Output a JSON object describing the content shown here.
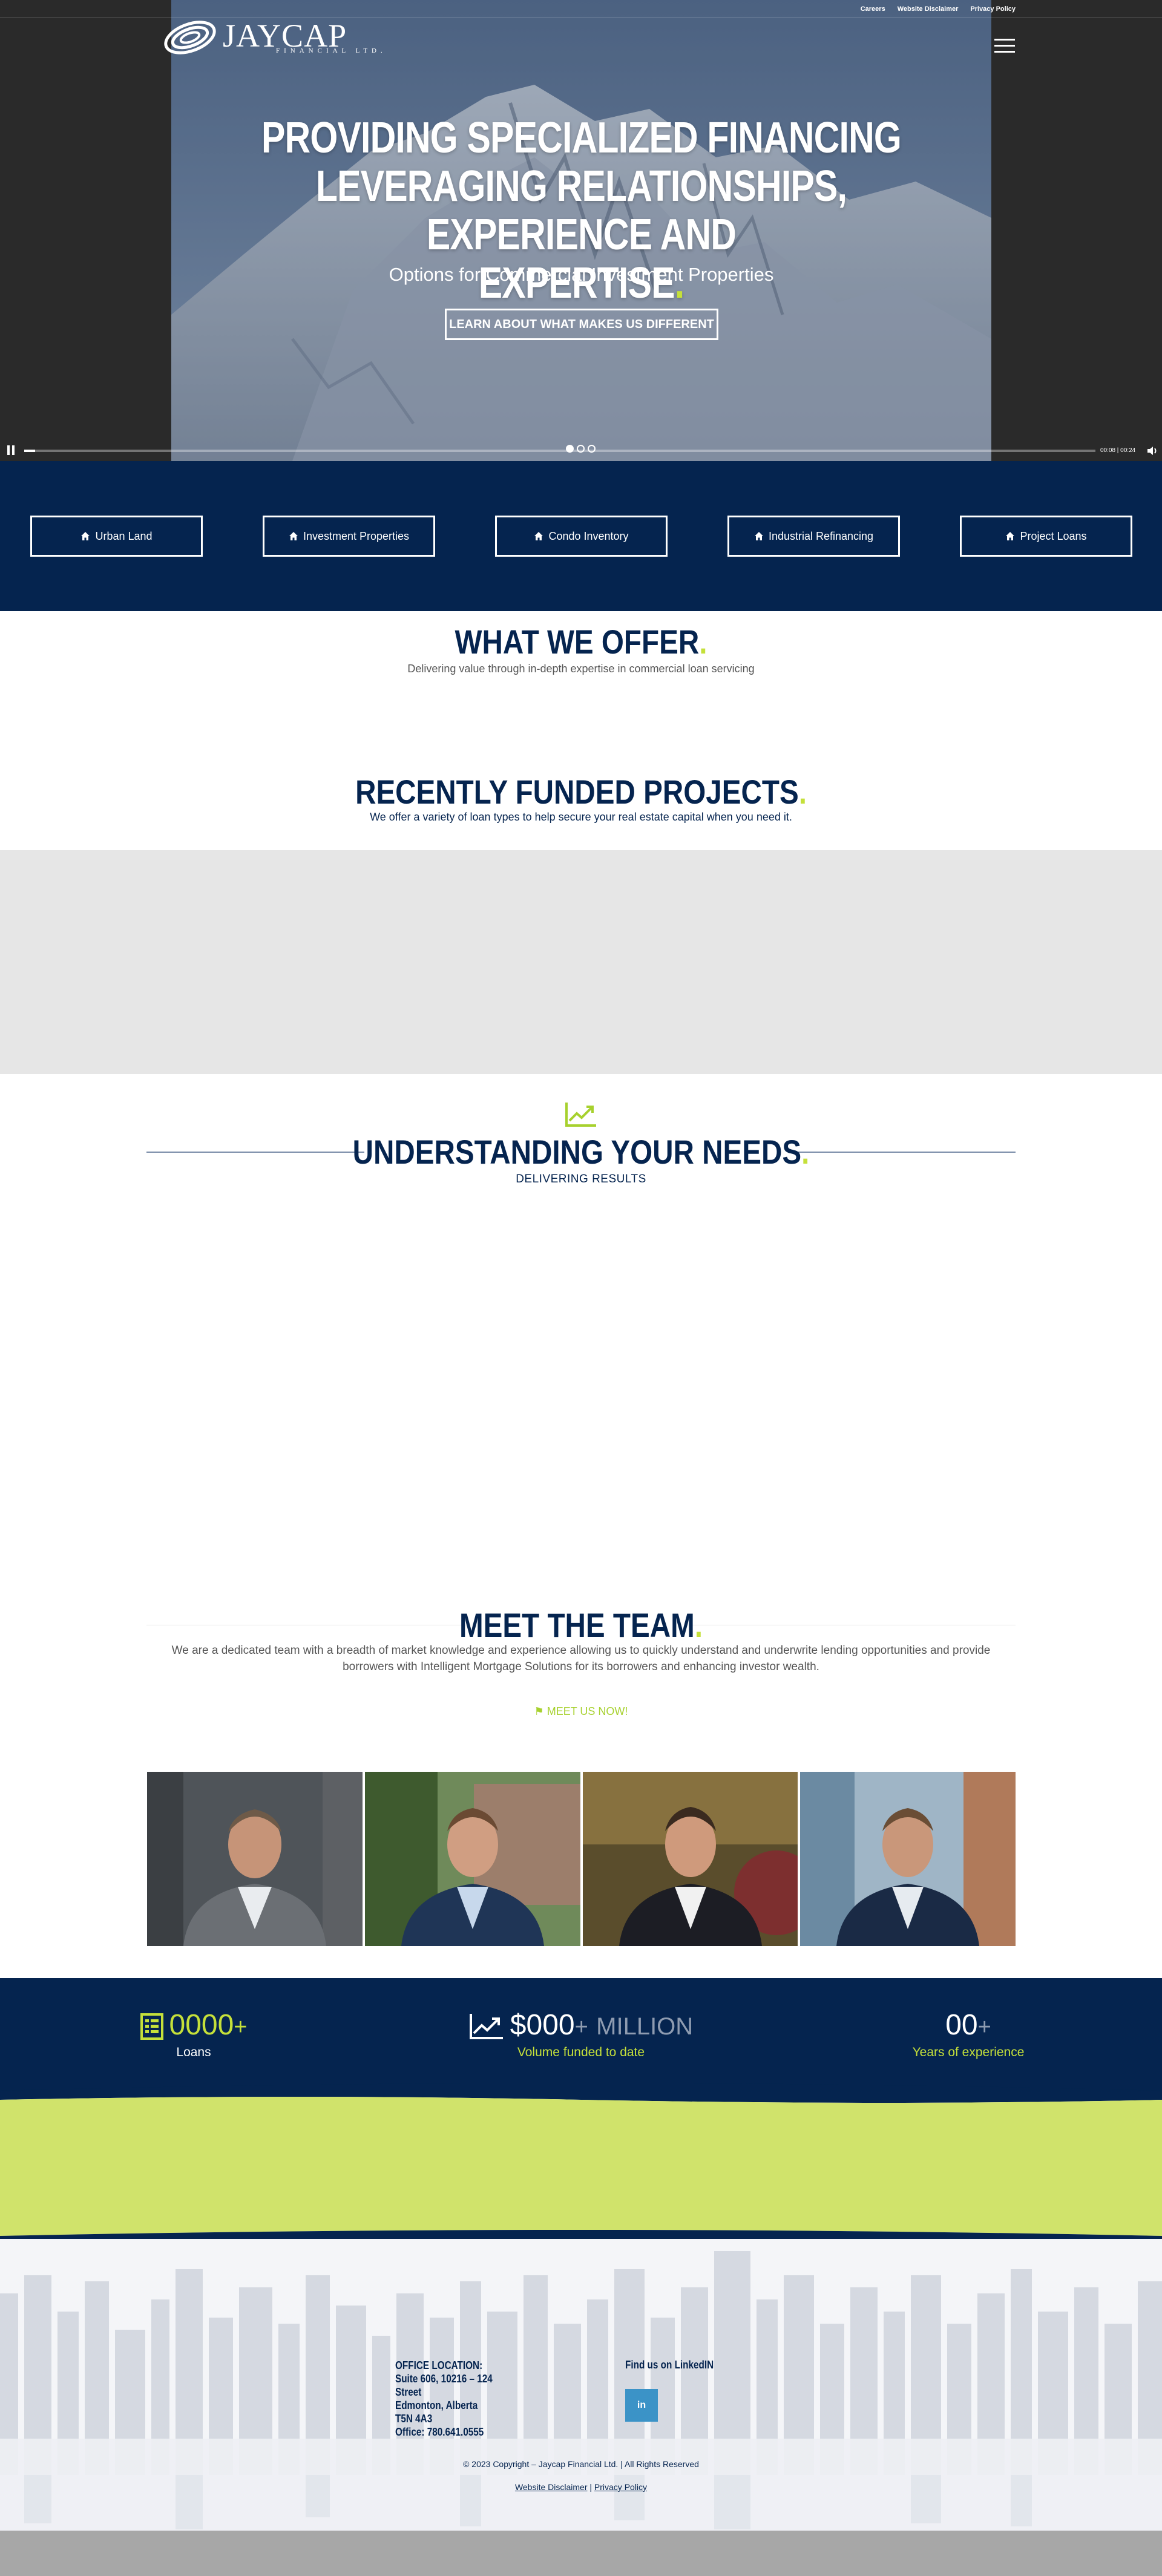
{
  "colors": {
    "navy": "#05244f",
    "lime": "#c5e03a",
    "linkedin": "#3b93c7"
  },
  "topbar": {
    "links": [
      "Careers",
      "Website Disclaimer",
      "Privacy Policy"
    ]
  },
  "brand": {
    "name": "JAYCAP",
    "tagline": "FINANCIAL LTD."
  },
  "hero": {
    "title_line1": "PROVIDING SPECIALIZED FINANCING",
    "title_line2": "LEVERAGING RELATIONSHIPS, EXPERIENCE AND",
    "title_line3": "EXPERTISE",
    "title_dot": ".",
    "subtitle": "Options for Commercial Investment Properties",
    "cta": "LEARN ABOUT WHAT MAKES US DIFFERENT",
    "video_time": "00:08 | 00:24",
    "progress": 0.01,
    "slides": 3,
    "active_slide": 1
  },
  "categories": [
    "Urban Land",
    "Investment Properties",
    "Condo Inventory",
    "Industrial Refinancing",
    "Project Loans"
  ],
  "offer": {
    "title": "WHAT WE OFFER",
    "dot": ".",
    "subtitle": "Delivering value through in-depth expertise in commercial loan servicing"
  },
  "projects": {
    "title": "RECENTLY FUNDED PROJECTS",
    "dot": ".",
    "subtitle": "We offer a variety of loan types to help secure your real estate capital when you need it."
  },
  "needs": {
    "title": "UNDERSTANDING YOUR NEEDS",
    "dot": ".",
    "subtitle": "DELIVERING RESULTS",
    "icon": "chart-line-icon"
  },
  "team": {
    "title": "MEET THE TEAM",
    "dot": ".",
    "description": "We are a dedicated team with a breadth of market knowledge and experience allowing us to quickly understand and underwrite lending opportunities and provide borrowers with Intelligent Mortgage Solutions for its borrowers and enhancing investor wealth.",
    "cta": "MEET US NOW!"
  },
  "stats": [
    {
      "prefix": "",
      "number": "0000",
      "suffix": "+",
      "unit": "",
      "label": "Loans",
      "icon": "list-icon"
    },
    {
      "prefix": "$",
      "number": "000",
      "suffix": "+",
      "unit": "MILLION",
      "label": "Volume funded to date",
      "icon": "chart-line-icon"
    },
    {
      "prefix": "",
      "number": "00",
      "suffix": "+",
      "unit": "",
      "label": "Years of experience",
      "icon": ""
    }
  ],
  "footer": {
    "office_heading": "OFFICE LOCATION:",
    "office_line1": "Suite 606, 10216 – 124",
    "office_line2": "Street",
    "office_line3": "Edmonton, Alberta",
    "office_line4": "T5N 4A3",
    "office_phone": "Office: 780.641.0555",
    "find_us": "Find us on LinkedIN",
    "linkedin": "in",
    "copyright": "© 2023 Copyright – Jaycap Financial Ltd. | All Rights Reserved",
    "disclaimer": "Website Disclaimer",
    "separator": "|",
    "privacy": "Privacy Policy"
  }
}
